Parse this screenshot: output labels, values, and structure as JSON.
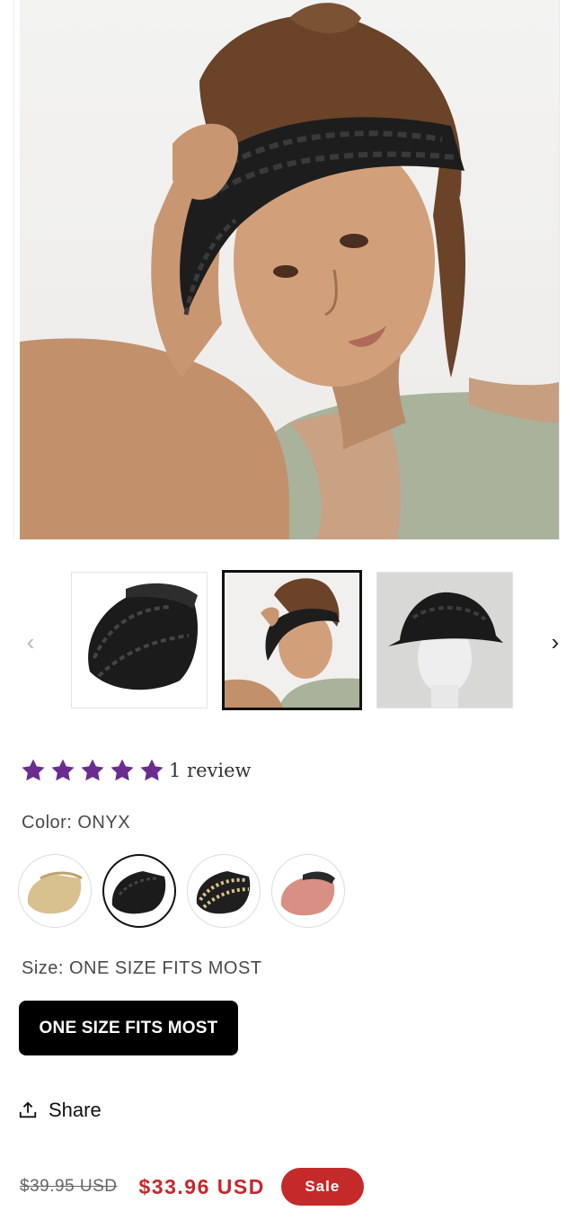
{
  "product": {
    "main_image_alt": "Woman wearing a black woven straw visor",
    "thumbnails": [
      {
        "alt": "Black woven visor product shot",
        "selected": false
      },
      {
        "alt": "Model wearing black visor",
        "selected": true
      },
      {
        "alt": "Black visor on mannequin head",
        "selected": false
      }
    ],
    "gallery_prev_icon": "chevron-left-icon",
    "gallery_next_icon": "chevron-right-icon"
  },
  "rating": {
    "stars": 5,
    "star_color": "#6b2c8f",
    "review_text": "1 review"
  },
  "color": {
    "label": "Color:",
    "value": "ONYX",
    "swatches": [
      {
        "name": "natural",
        "selected": false
      },
      {
        "name": "onyx",
        "selected": true
      },
      {
        "name": "black-natural",
        "selected": false
      },
      {
        "name": "blush",
        "selected": false
      }
    ]
  },
  "size": {
    "label": "Size:",
    "value": "ONE SIZE FITS MOST",
    "option_label": "ONE SIZE FITS MOST"
  },
  "share": {
    "label": "Share",
    "icon": "share-icon"
  },
  "price": {
    "regular": "$39.95 USD",
    "sale": "$33.96 USD",
    "badge": "Sale",
    "sale_color": "#c9252a"
  }
}
